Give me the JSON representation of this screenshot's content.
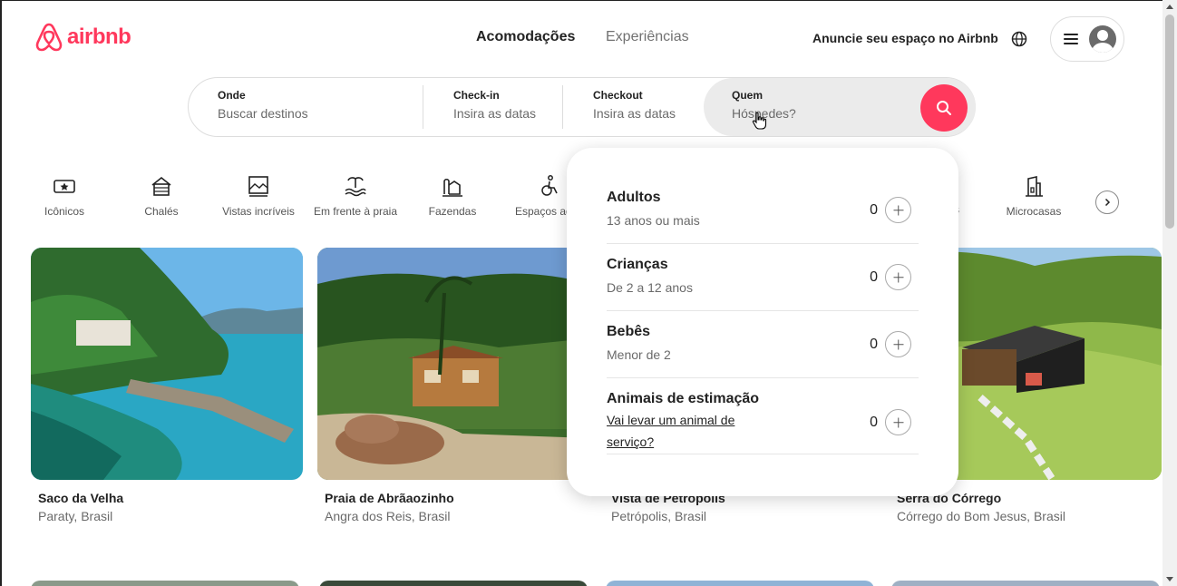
{
  "header": {
    "logo_text": "airbnb",
    "tabs": [
      {
        "label": "Acomodações",
        "active": true
      },
      {
        "label": "Experiências",
        "active": false
      }
    ],
    "host_link": "Anuncie seu espaço no Airbnb",
    "globe_icon": "globe-icon",
    "menu_icon": "hamburger-icon",
    "avatar_icon": "user-avatar-icon"
  },
  "search": {
    "where": {
      "label": "Onde",
      "placeholder": "Buscar destinos"
    },
    "checkin": {
      "label": "Check-in",
      "placeholder": "Insira as datas"
    },
    "checkout": {
      "label": "Checkout",
      "placeholder": "Insira as datas"
    },
    "who": {
      "label": "Quem",
      "placeholder": "Hóspedes?"
    },
    "button_icon": "search-icon"
  },
  "categories": [
    {
      "label": "Icônicos",
      "icon": "ticket-star-icon"
    },
    {
      "label": "Chalés",
      "icon": "cabin-icon"
    },
    {
      "label": "Vistas incríveis",
      "icon": "view-frame-icon"
    },
    {
      "label": "Em frente à praia",
      "icon": "beachfront-icon"
    },
    {
      "label": "Fazendas",
      "icon": "farm-icon"
    },
    {
      "label": "Espaços adap",
      "icon": "accessible-icon"
    },
    {
      "label": "s",
      "icon": ""
    },
    {
      "label": "Microcasas",
      "icon": "tiny-house-icon"
    }
  ],
  "listings": [
    {
      "title": "Saco da Velha",
      "location": "Paraty, Brasil"
    },
    {
      "title": "Praia de Abrãaozinho",
      "location": "Angra dos Reis, Brasil"
    },
    {
      "title": "Vista de Petrópolis",
      "location": "Petrópolis, Brasil"
    },
    {
      "title": "Serra do Córrego",
      "location": "Córrego do Bom Jesus, Brasil"
    }
  ],
  "guests_popup": {
    "rows": [
      {
        "name": "Adultos",
        "desc": "13 anos ou mais",
        "count": "0"
      },
      {
        "name": "Crianças",
        "desc": "De 2 a 12 anos",
        "count": "0"
      },
      {
        "name": "Bebês",
        "desc": "Menor de 2",
        "count": "0"
      },
      {
        "name": "Animais de estimação",
        "desc": "Vai levar um animal de serviço?",
        "count": "0"
      }
    ]
  },
  "colors": {
    "brand": "#FF385C",
    "text": "#222222",
    "muted": "#6A6A6A"
  }
}
